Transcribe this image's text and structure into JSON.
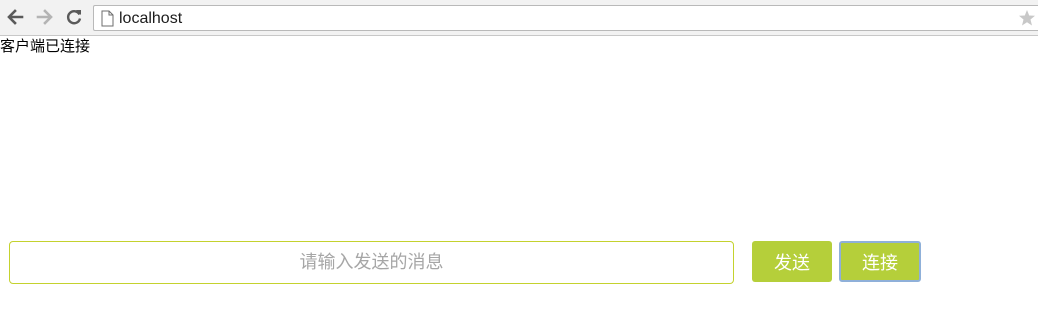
{
  "browser": {
    "url": "localhost",
    "icons": {
      "back": "arrow-left-icon",
      "forward": "arrow-right-icon",
      "reload": "reload-icon",
      "page": "page-icon",
      "bookmark": "star-icon"
    }
  },
  "page": {
    "status_text": "客户端已连接",
    "message_input": {
      "placeholder": "请输入发送的消息",
      "value": ""
    },
    "send_button_label": "发送",
    "connect_button_label": "连接"
  },
  "colors": {
    "accent_green": "#b5cf3a",
    "input_border": "#c4d22e",
    "focus_ring": "#8fb0d9"
  }
}
